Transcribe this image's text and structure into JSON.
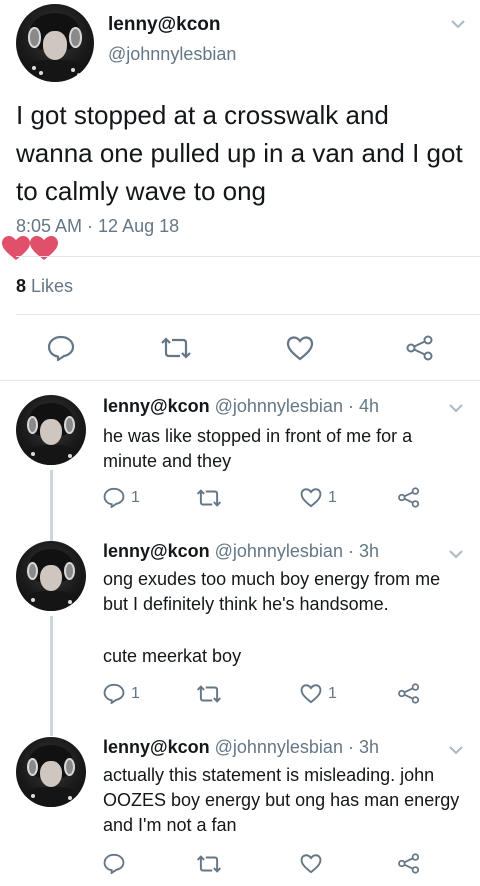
{
  "main_tweet": {
    "name": "lenny@kcon",
    "handle": "@johnnylesbian",
    "text": "I got stopped at a crosswalk and wanna one pulled up in a van and I got to calmly wave to ong",
    "timestamp": "8:05 AM · 12 Aug 18",
    "likes_count": "8",
    "likes_label": "Likes"
  },
  "replies": [
    {
      "name": "lenny@kcon",
      "handle": "@johnnylesbian",
      "time": "4h",
      "text": "he was like stopped in front of me for a minute and they",
      "reply_count": "1",
      "like_count": "1"
    },
    {
      "name": "lenny@kcon",
      "handle": "@johnnylesbian",
      "time": "3h",
      "text": "ong exudes too much boy energy from me but I definitely think he's handsome.",
      "text2": "cute meerkat boy",
      "reply_count": "1",
      "like_count": "1"
    },
    {
      "name": "lenny@kcon",
      "handle": "@johnnylesbian",
      "time": "3h",
      "text": "actually this statement is misleading. john OOZES boy energy but ong has man energy and I'm not a fan",
      "reply_count": "",
      "like_count": ""
    }
  ],
  "colors": {
    "text": "#14171a",
    "secondary": "#657786",
    "divider": "#e1e8ed",
    "heart_sticker": "#e0506a"
  }
}
